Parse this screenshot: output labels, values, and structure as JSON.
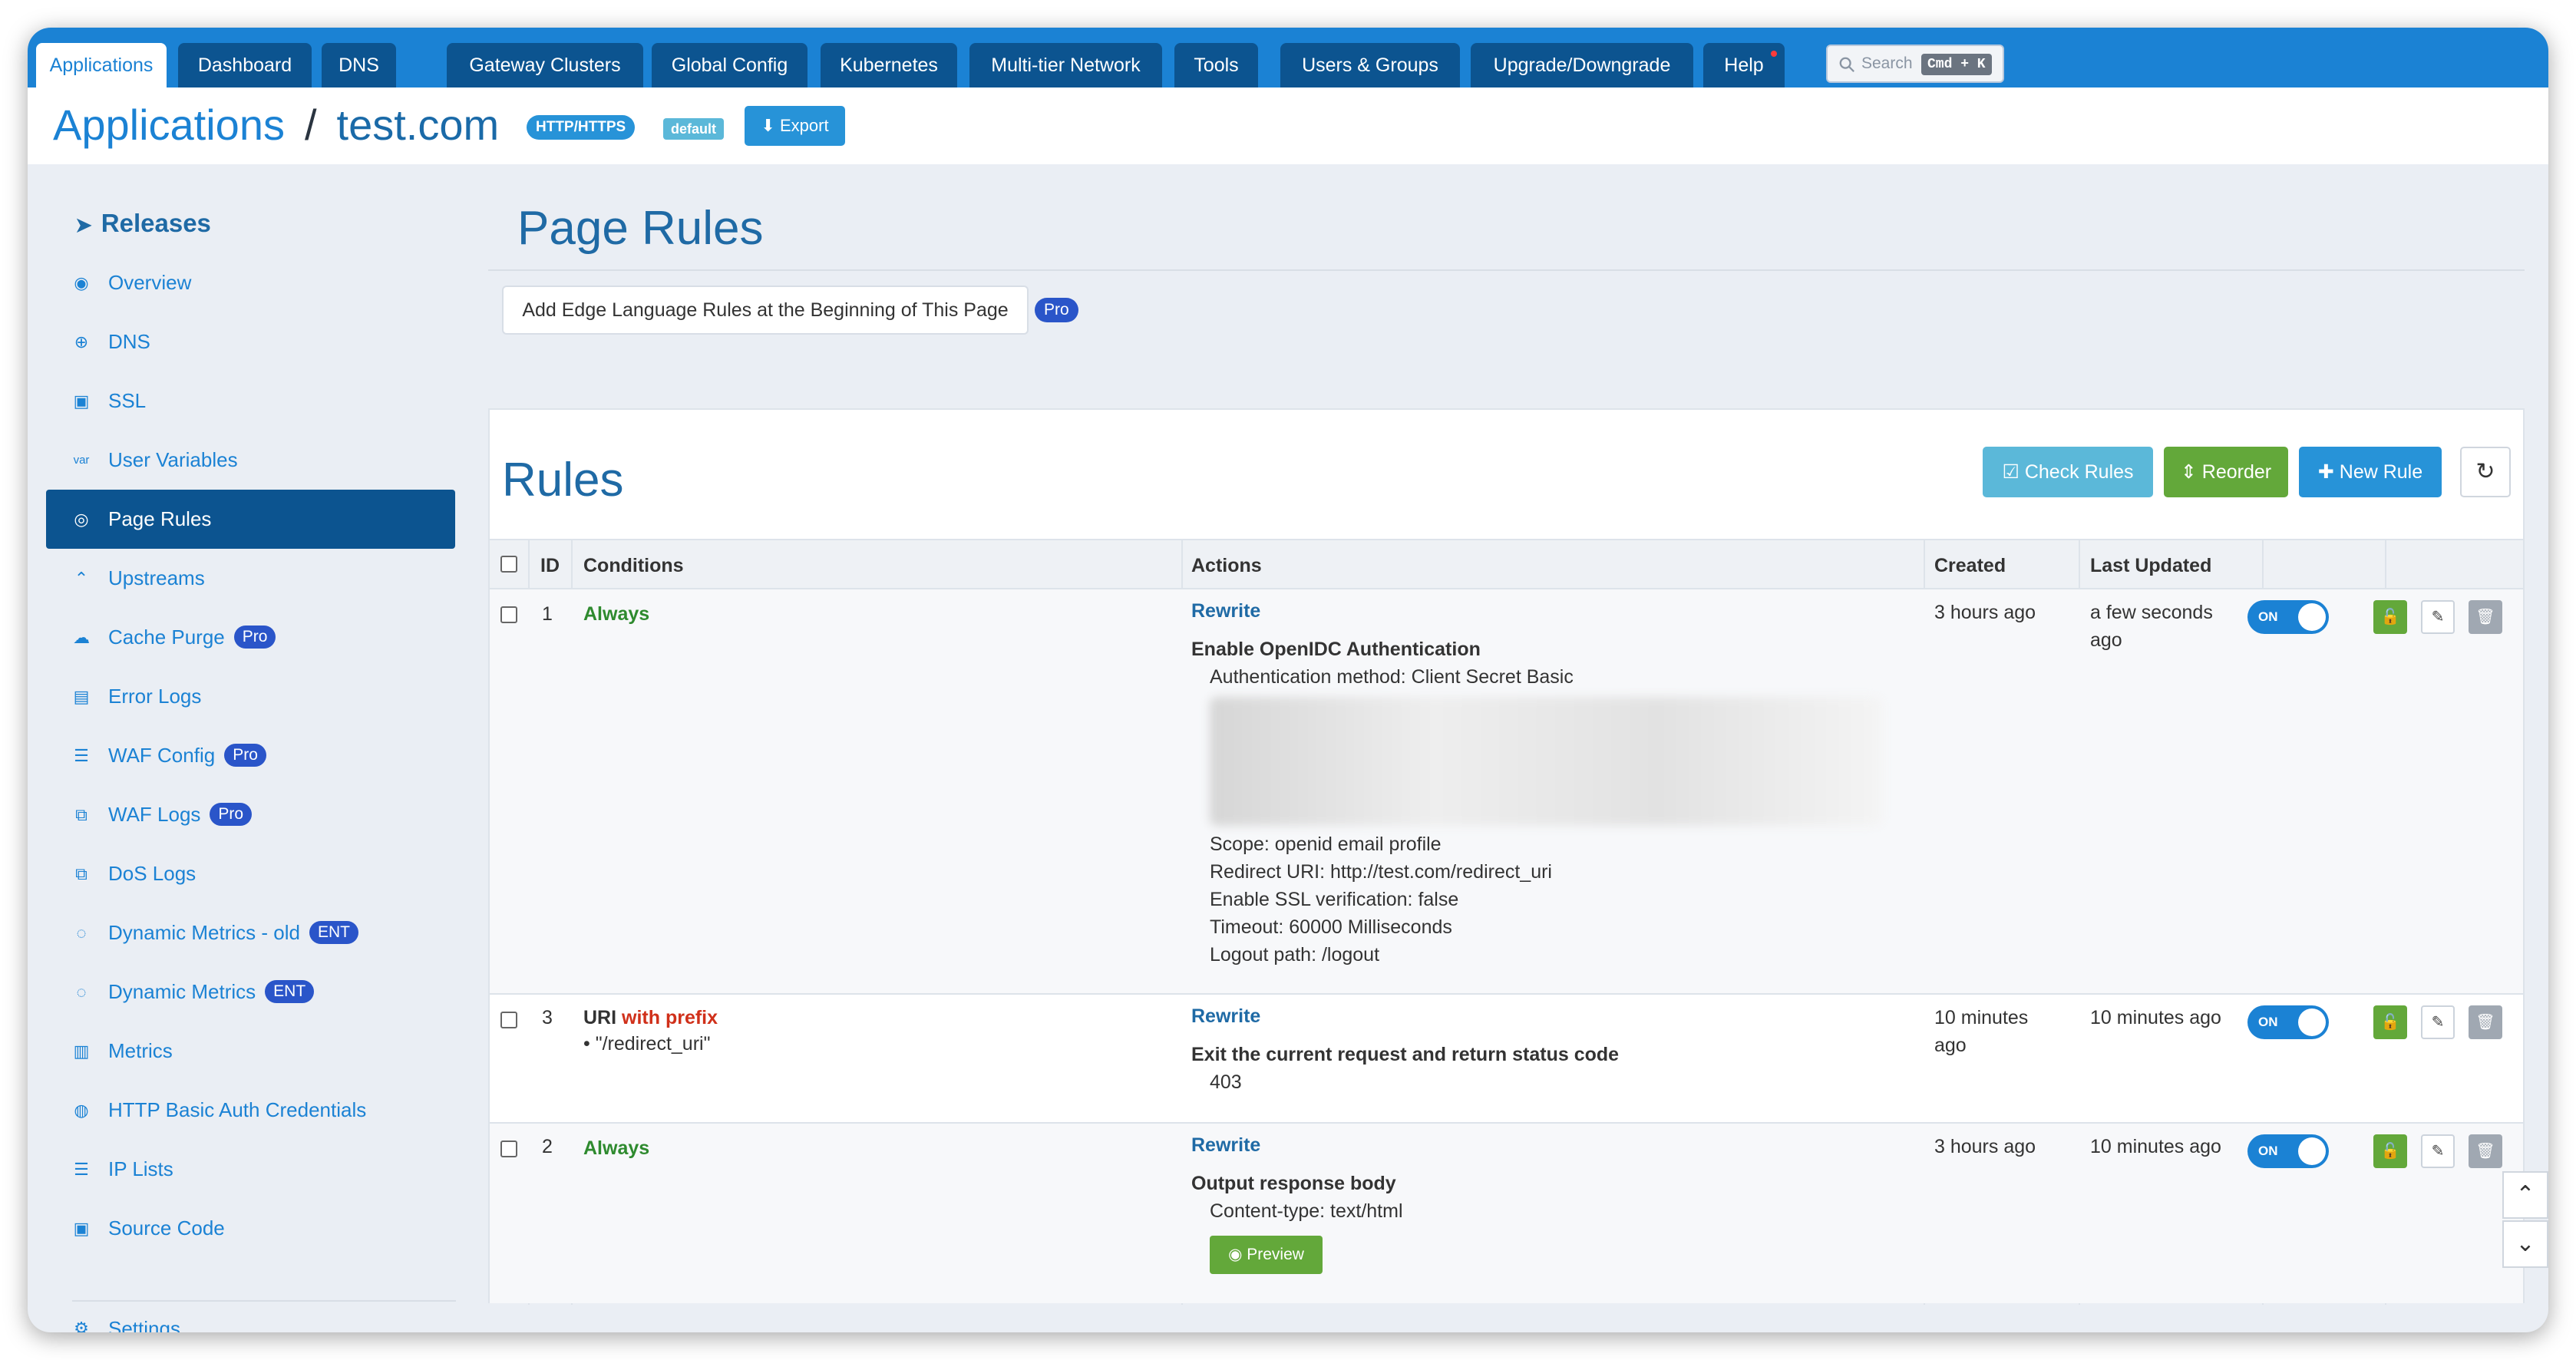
{
  "topnav": {
    "tabs": [
      {
        "label": "Applications",
        "active": true
      },
      {
        "label": "Dashboard"
      },
      {
        "label": "DNS"
      },
      {
        "label": "Gateway Clusters"
      },
      {
        "label": "Global Config"
      },
      {
        "label": "Kubernetes"
      },
      {
        "label": "Multi-tier Network"
      },
      {
        "label": "Tools"
      },
      {
        "label": "Users & Groups"
      },
      {
        "label": "Upgrade/Downgrade"
      },
      {
        "label": "Help"
      }
    ],
    "search_placeholder": "Search",
    "search_shortcut": "Cmd + K"
  },
  "header": {
    "crumb_root": "Applications",
    "crumb_sep": "/",
    "crumb_app": "test.com",
    "protocol_badge": "HTTP/HTTPS",
    "default_badge": "default",
    "export_label": "Export"
  },
  "sidebar": {
    "title": "Releases",
    "items": [
      {
        "label": "Overview",
        "icon": "dashboard-icon"
      },
      {
        "label": "DNS",
        "icon": "globe-icon"
      },
      {
        "label": "SSL",
        "icon": "certificate-icon"
      },
      {
        "label": "User Variables",
        "icon": "var-icon"
      },
      {
        "label": "Page Rules",
        "icon": "rules-icon",
        "active": true
      },
      {
        "label": "Upstreams",
        "icon": "upstream-icon"
      },
      {
        "label": "Cache Purge",
        "icon": "cloud-icon",
        "badge": "Pro"
      },
      {
        "label": "Error Logs",
        "icon": "log-icon"
      },
      {
        "label": "WAF Config",
        "icon": "waf-config-icon",
        "badge": "Pro"
      },
      {
        "label": "WAF Logs",
        "icon": "waf-logs-icon",
        "badge": "Pro"
      },
      {
        "label": "DoS Logs",
        "icon": "dos-icon"
      },
      {
        "label": "Dynamic Metrics - old",
        "icon": "metrics-old-icon",
        "badge": "ENT"
      },
      {
        "label": "Dynamic Metrics",
        "icon": "dynamic-metrics-icon",
        "badge": "ENT"
      },
      {
        "label": "Metrics",
        "icon": "bar-chart-icon"
      },
      {
        "label": "HTTP Basic Auth Credentials",
        "icon": "fingerprint-icon"
      },
      {
        "label": "IP Lists",
        "icon": "list-icon"
      },
      {
        "label": "Source Code",
        "icon": "terminal-icon"
      }
    ],
    "settings_label": "Settings"
  },
  "main": {
    "page_title": "Page Rules",
    "edge_button_label": "Add Edge Language Rules at the Beginning of This Page",
    "edge_badge": "Pro",
    "rules_title": "Rules",
    "check_rules_label": "Check Rules",
    "reorder_label": "Reorder",
    "new_rule_label": "New Rule",
    "columns": {
      "id": "ID",
      "conditions": "Conditions",
      "actions": "Actions",
      "created": "Created",
      "updated": "Last Updated"
    },
    "rows": [
      {
        "id": "1",
        "condition": "Always",
        "action_type": "Rewrite",
        "action_title": "Enable OpenIDC Authentication",
        "action_lines_top": [
          "Authentication method: Client Secret Basic"
        ],
        "action_lines": [
          "Scope: openid email profile",
          "Redirect URI: http://test.com/redirect_uri",
          "Enable SSL verification: false",
          "Timeout: 60000 Milliseconds",
          "Logout path: /logout"
        ],
        "created": "3 hours ago",
        "updated_line1": "a few seconds",
        "updated_line2": "ago",
        "toggle": "ON"
      },
      {
        "id": "3",
        "condition_prefix": "URI",
        "condition_op": "with prefix",
        "condition_value": "\"/redirect_uri\"",
        "action_type": "Rewrite",
        "action_title": "Exit the current request and return status code",
        "action_value": "403",
        "created_line1": "10 minutes",
        "created_line2": "ago",
        "updated": "10 minutes ago",
        "toggle": "ON"
      },
      {
        "id": "2",
        "condition": "Always",
        "action_type": "Rewrite",
        "action_title": "Output response body",
        "action_value": "Content-type: text/html",
        "preview_label": "Preview",
        "created": "3 hours ago",
        "updated": "10 minutes ago",
        "toggle": "ON"
      }
    ]
  },
  "colors": {
    "brand_blue": "#1b82d4",
    "nav_dark": "#0c5490",
    "title_blue": "#1f6aa5",
    "green": "#63a83a",
    "check_rules": "#5bb8d9"
  }
}
